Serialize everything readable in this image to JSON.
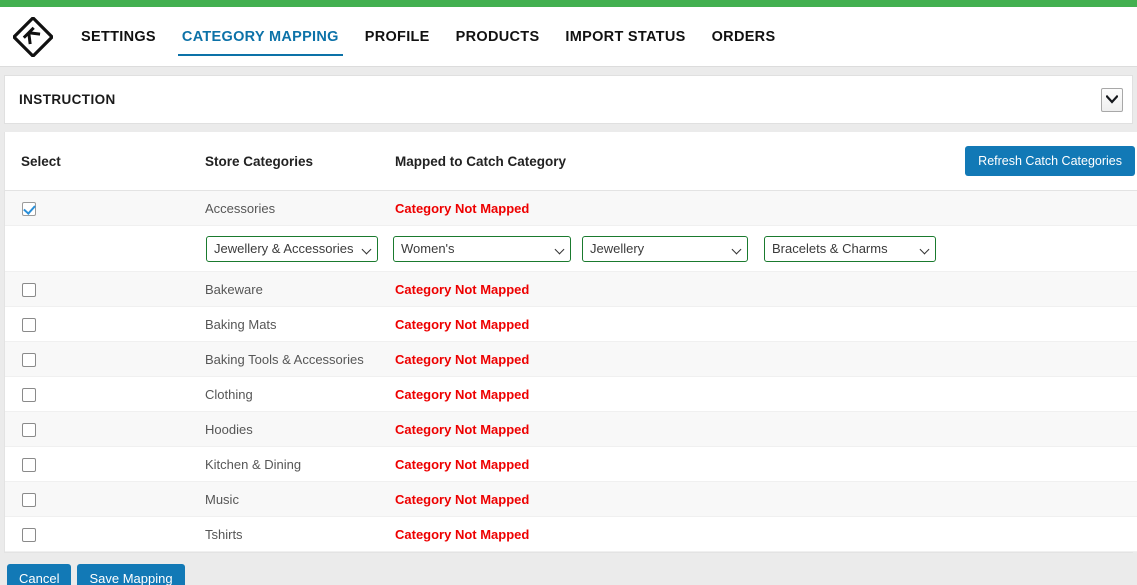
{
  "theme": {
    "accent_green": "#43b050",
    "accent_blue": "#1279b6",
    "link_blue": "#0c72a8",
    "error_red": "#ee0000",
    "select_border_green": "#1a7a2e"
  },
  "header": {
    "logo_name": "app-logo",
    "nav": [
      {
        "label": "SETTINGS",
        "active": false
      },
      {
        "label": "CATEGORY MAPPING",
        "active": true
      },
      {
        "label": "PROFILE",
        "active": false
      },
      {
        "label": "PRODUCTS",
        "active": false
      },
      {
        "label": "IMPORT STATUS",
        "active": false
      },
      {
        "label": "ORDERS",
        "active": false
      }
    ]
  },
  "instruction": {
    "title": "INSTRUCTION",
    "expanded": false
  },
  "table": {
    "headers": {
      "select": "Select",
      "store_categories": "Store Categories",
      "mapped_to_catch": "Mapped to Catch Category"
    },
    "refresh_button": "Refresh Catch Categories",
    "not_mapped_text": "Category Not Mapped",
    "rows": [
      {
        "checked": true,
        "store_category": "Accessories",
        "status": "Category Not Mapped"
      },
      {
        "checked": false,
        "store_category": "Bakeware",
        "status": "Category Not Mapped"
      },
      {
        "checked": false,
        "store_category": "Baking Mats",
        "status": "Category Not Mapped"
      },
      {
        "checked": false,
        "store_category": "Baking Tools & Accessories",
        "status": "Category Not Mapped"
      },
      {
        "checked": false,
        "store_category": "Clothing",
        "status": "Category Not Mapped"
      },
      {
        "checked": false,
        "store_category": "Hoodies",
        "status": "Category Not Mapped"
      },
      {
        "checked": false,
        "store_category": "Kitchen & Dining",
        "status": "Category Not Mapped"
      },
      {
        "checked": false,
        "store_category": "Music",
        "status": "Category Not Mapped"
      },
      {
        "checked": false,
        "store_category": "Tshirts",
        "status": "Category Not Mapped"
      }
    ],
    "mapping_selects": [
      {
        "name": "store-category-select",
        "value": "Jewellery & Accessories"
      },
      {
        "name": "catch-level1-select",
        "value": "Women's"
      },
      {
        "name": "catch-level2-select",
        "value": "Jewellery"
      },
      {
        "name": "catch-level3-select",
        "value": "Bracelets & Charms"
      }
    ]
  },
  "footer": {
    "cancel_label": "Cancel",
    "save_label": "Save Mapping"
  }
}
